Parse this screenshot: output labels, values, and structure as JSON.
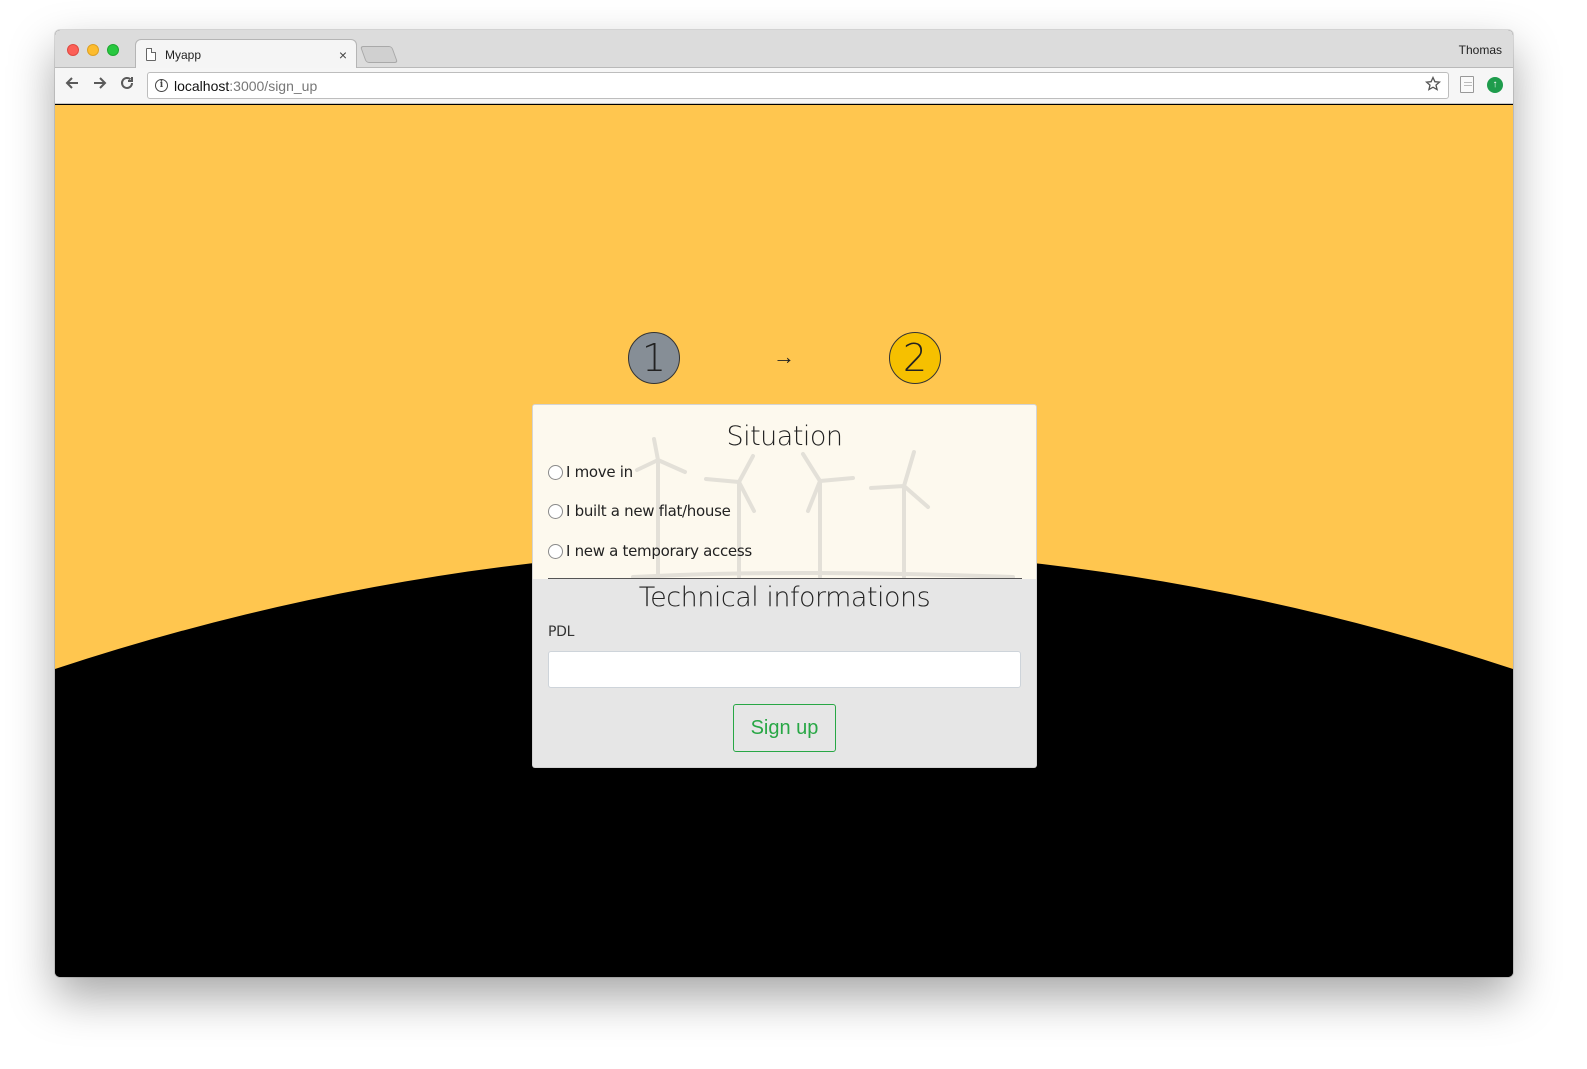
{
  "browser": {
    "tab_title": "Myapp",
    "tab_close": "×",
    "profile_name": "Thomas",
    "url_host": "localhost",
    "url_rest": ":3000/sign_up",
    "icons": {
      "back": "arrow-left-icon",
      "forward": "arrow-right-icon",
      "reload": "reload-icon",
      "info": "info-icon",
      "bookmark": "star-icon",
      "extension": "note-icon",
      "update": "arrow-up-circle-icon"
    }
  },
  "steps": {
    "step1": "1",
    "arrow": "→",
    "step2": "2"
  },
  "form": {
    "situation_title": "Situation",
    "options": [
      "I move in",
      "I built a new flat/house",
      "I new a temporary access"
    ],
    "tech_title": "Technical informations",
    "pdl_label": "PDL",
    "pdl_value": "",
    "submit_label": "Sign up"
  },
  "colors": {
    "sky": "#ffc64f",
    "ground": "#000000",
    "step1_bg": "#868e96",
    "step2_bg": "#f6c000",
    "button": "#28a745"
  }
}
